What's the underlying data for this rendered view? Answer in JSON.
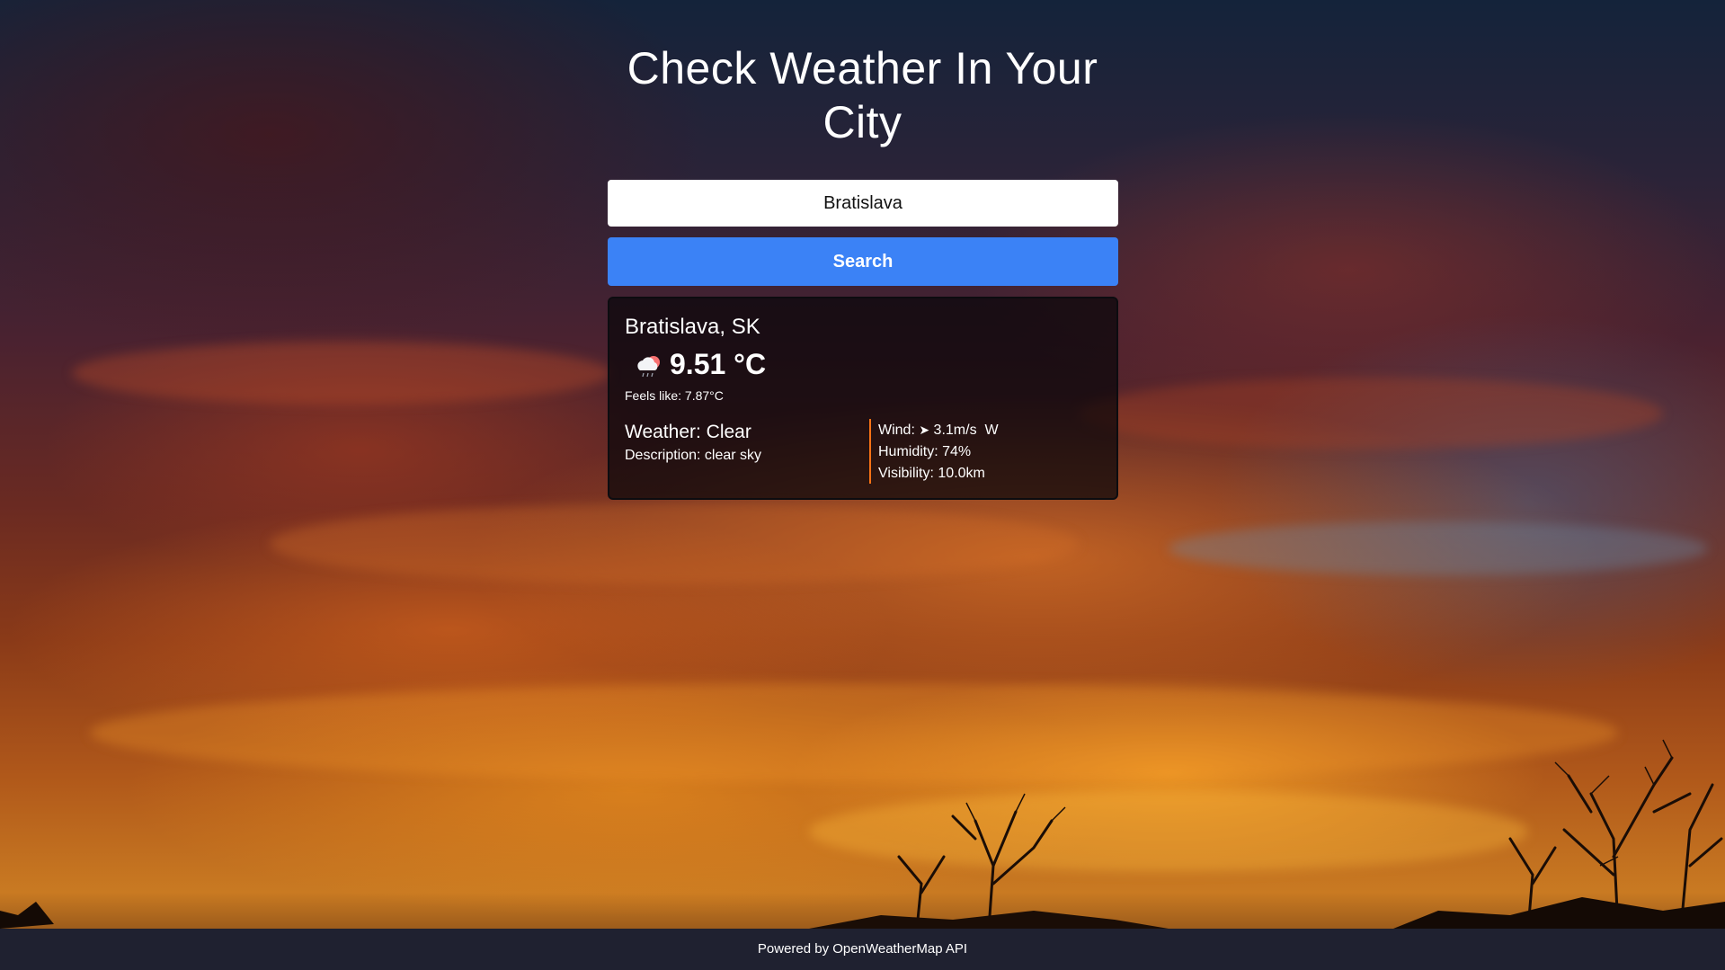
{
  "header": {
    "title": "Check Weather In Your City"
  },
  "search": {
    "value": "Bratislava",
    "button_label": "Search"
  },
  "weather": {
    "location": "Bratislava, SK",
    "icon": "cloud-sun-rain-icon",
    "temperature": "9.51 °C",
    "feels_like": "Feels like: 7.87°C",
    "main": "Weather: Clear",
    "description": "Description: clear sky",
    "wind_label": "Wind:",
    "wind_arrow_icon": "wind-direction-arrow-icon",
    "wind_value": "3.1m/s  W",
    "humidity": "Humidity: 74%",
    "visibility": "Visibility: 10.0km"
  },
  "footer": {
    "text": "Powered by OpenWeatherMap API"
  },
  "colors": {
    "button": "#3b82f6",
    "accent_border": "#f97316",
    "footer_bg": "#1f2130"
  }
}
